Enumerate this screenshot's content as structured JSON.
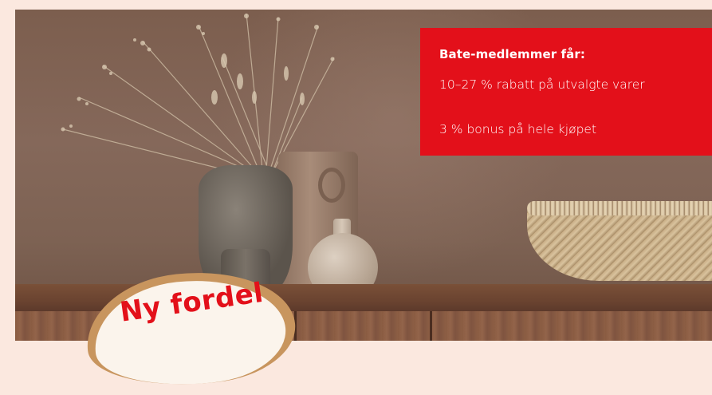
{
  "info_box": {
    "title": "Bate-medlemmer får:",
    "lines": [
      "10–27 % rabatt på utvalgte varer",
      "3 % bonus på hele kjøpet"
    ],
    "background_color": "#e3101a",
    "text_color": "#ffffff"
  },
  "sticker": {
    "label": "Ny fordel",
    "text_color": "#e3101a"
  },
  "page_background": "#fbe8df"
}
